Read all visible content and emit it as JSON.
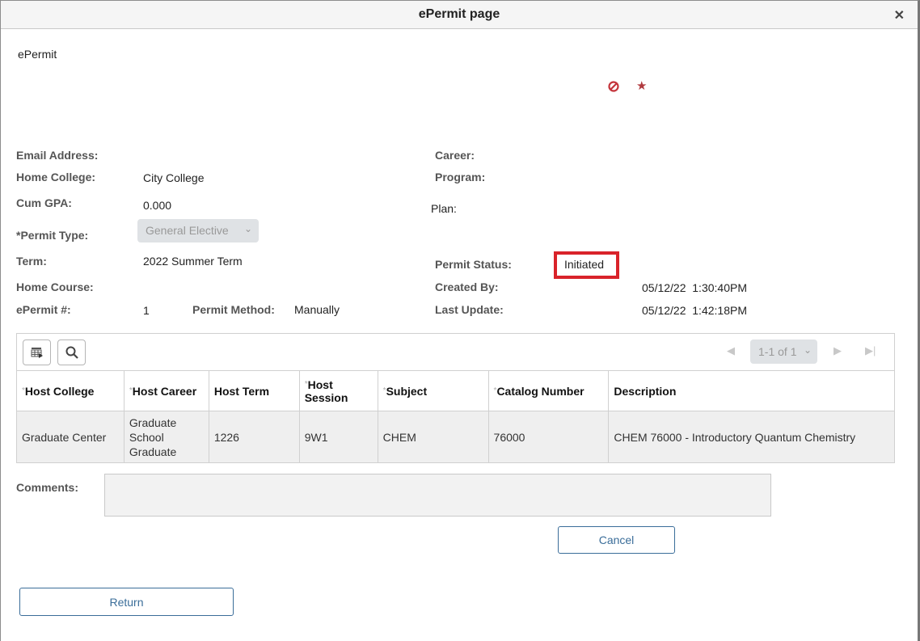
{
  "window": {
    "title": "ePermit page",
    "close_icon": "close-icon"
  },
  "page": {
    "heading": "ePermit",
    "icons": [
      "block-icon",
      "star-icon"
    ]
  },
  "form": {
    "email_label": "Email Address:",
    "email_value": "",
    "home_college_label": "Home College:",
    "home_college_value": "City College",
    "cum_gpa_label": "Cum GPA:",
    "cum_gpa_value": "0.000",
    "permit_type_label": "*Permit Type:",
    "permit_type_value": "General Elective",
    "term_label": "Term:",
    "term_value": "2022 Summer Term",
    "home_course_label": "Home Course:",
    "home_course_value": "",
    "epermit_no_label": "ePermit #:",
    "epermit_no_value": "1",
    "permit_method_label": "Permit Method:",
    "permit_method_value": "Manually",
    "career_label": "Career:",
    "career_value": "",
    "program_label": "Program:",
    "program_value": "",
    "plan_label": "Plan:",
    "plan_value": "",
    "permit_status_label": "Permit Status:",
    "permit_status_value": "Initiated",
    "created_by_label": "Created By:",
    "created_by_value": "05/12/22  1:30:40PM",
    "last_update_label": "Last Update:",
    "last_update_value": "05/12/22  1:42:18PM"
  },
  "grid": {
    "toolbar": {
      "personalize_icon": "grid-settings-icon",
      "find_icon": "search-icon"
    },
    "pager": {
      "label": "1-1 of 1",
      "prev_icon": "triangle-left-icon",
      "next_icon": "triangle-right-icon",
      "last_icon": "skip-last-icon"
    },
    "columns": [
      {
        "label": "Host College",
        "required": true
      },
      {
        "label": "Host Career",
        "required": true
      },
      {
        "label": "Host Term",
        "required": false
      },
      {
        "label": "Host Session",
        "required": true
      },
      {
        "label": "Subject",
        "required": true
      },
      {
        "label": "Catalog Number",
        "required": true
      },
      {
        "label": "Description",
        "required": false
      }
    ],
    "rows": [
      [
        "Graduate Center",
        "Graduate School Graduate",
        "1226",
        "9W1",
        "CHEM",
        "76000",
        "CHEM 76000 - Introductory Quantum Chemistry"
      ]
    ],
    "required_marker": "*"
  },
  "comments": {
    "label": "Comments:",
    "value": ""
  },
  "buttons": {
    "cancel": "Cancel",
    "return": "Return"
  },
  "colors": {
    "highlight_box": "#d9232a",
    "button_text": "#3a6d99",
    "icon_red": "#b0393e"
  }
}
